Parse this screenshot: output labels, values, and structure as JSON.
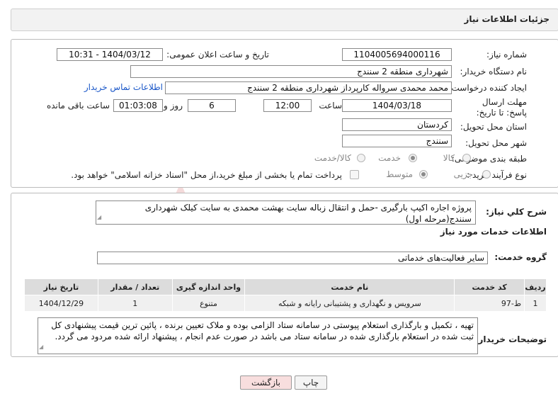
{
  "header": {
    "title": "جزئیات اطلاعات نیاز"
  },
  "form": {
    "need_number_label": "شماره نیاز:",
    "need_number": "1104005694000116",
    "announce_label": "تاریخ و ساعت اعلان عمومی:",
    "announce_value": "1404/03/12 - 10:31",
    "buyer_org_label": "نام دستگاه خریدار:",
    "buyer_org": "شهرداری منطقه 2 سنندج",
    "creator_label": "ایجاد کننده درخواست:",
    "creator": "محمد محمدی سرواله کارپرداز شهرداری منطقه 2 سنندج",
    "contact_link": "اطلاعات تماس خریدار",
    "deadline_label": "مهلت ارسال پاسخ: تا تاریخ:",
    "deadline_date": "1404/03/18",
    "time_label": "ساعت",
    "deadline_time": "12:00",
    "days_value": "6",
    "days_label": "روز و",
    "remaining_time": "01:03:08",
    "remaining_label": "ساعت باقی مانده",
    "province_label": "استان محل تحویل:",
    "province": "کردستان",
    "city_label": "شهر محل تحویل:",
    "city": "سنندج",
    "category_label": "طبقه بندی موضوعی:",
    "category_options": [
      "کالا",
      "خدمت",
      "کالا/خدمت"
    ],
    "process_label": "نوع فرآیند خرید :",
    "process_options": [
      "جزیی",
      "متوسط"
    ],
    "payment_note": "پرداخت تمام یا بخشی از مبلغ خرید،از محل \"اسناد خزانه اسلامی\" خواهد بود."
  },
  "summary": {
    "label": "شرح کلي نياز:",
    "text": "پروژه اجاره اکیپ بارگیری -حمل و انتقال زباله سایت بهشت محمدی به سایت کیلک شهرداری سنندج(مرحله اول)",
    "services_title": "اطلاعات خدمات مورد نیاز",
    "group_label": "گروه خدمت:",
    "group_value": "سایر فعالیت‌های خدماتی"
  },
  "table": {
    "headers": [
      "ردیف",
      "کد خدمت",
      "نام خدمت",
      "واحد اندازه گیری",
      "تعداد / مقدار",
      "تاریخ نیاز"
    ],
    "rows": [
      [
        "1",
        "ط-97",
        "سرویس و نگهداری و پشتیبانی رایانه و شبکه",
        "متنوع",
        "1",
        "1404/12/29"
      ]
    ]
  },
  "notes": {
    "label": "توضیحات خریدار:",
    "text": "تهیه  ، تکمیل و بارگذاری استعلام پیوستی در سامانه ستاد الزامی بوده و ملاک تعیین برنده ، پائین ترین قیمت پیشنهادی کل ثبت شده در استعلام بارگذاری شده در سامانه ستاد می باشد در صورت عدم انجام ، پیشنهاد ارائه شده مردود می گردد."
  },
  "buttons": {
    "print": "چاپ",
    "back": "بازگشت"
  },
  "colors": {
    "link": "#1a57c8",
    "back_button_bg": "#f8dede",
    "header_bg": "#f2f2f2"
  }
}
